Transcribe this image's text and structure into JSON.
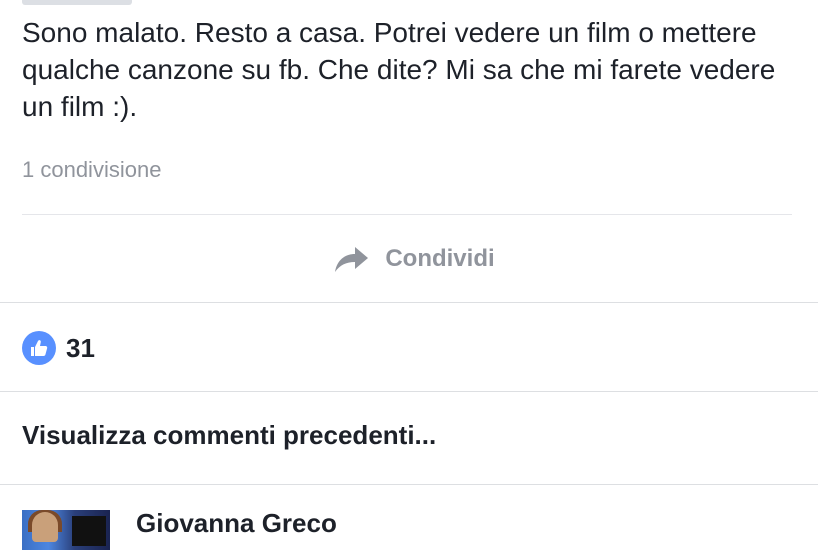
{
  "post": {
    "text": "Sono malato. Resto a casa. Potrei vedere un film o mettere qualche canzone su fb. Che dite? Mi sa che mi farete vedere un film :).",
    "share_count": "1 condivisione"
  },
  "actions": {
    "share_label": "Condividi",
    "share_icon": "share-arrow-icon"
  },
  "reactions": {
    "like_icon": "like-thumb-icon",
    "like_count": "31",
    "badge_color": "#5890ff"
  },
  "comments": {
    "view_previous": "Visualizza commenti precedenti...",
    "items": [
      {
        "author": "Giovanna Greco"
      }
    ]
  }
}
